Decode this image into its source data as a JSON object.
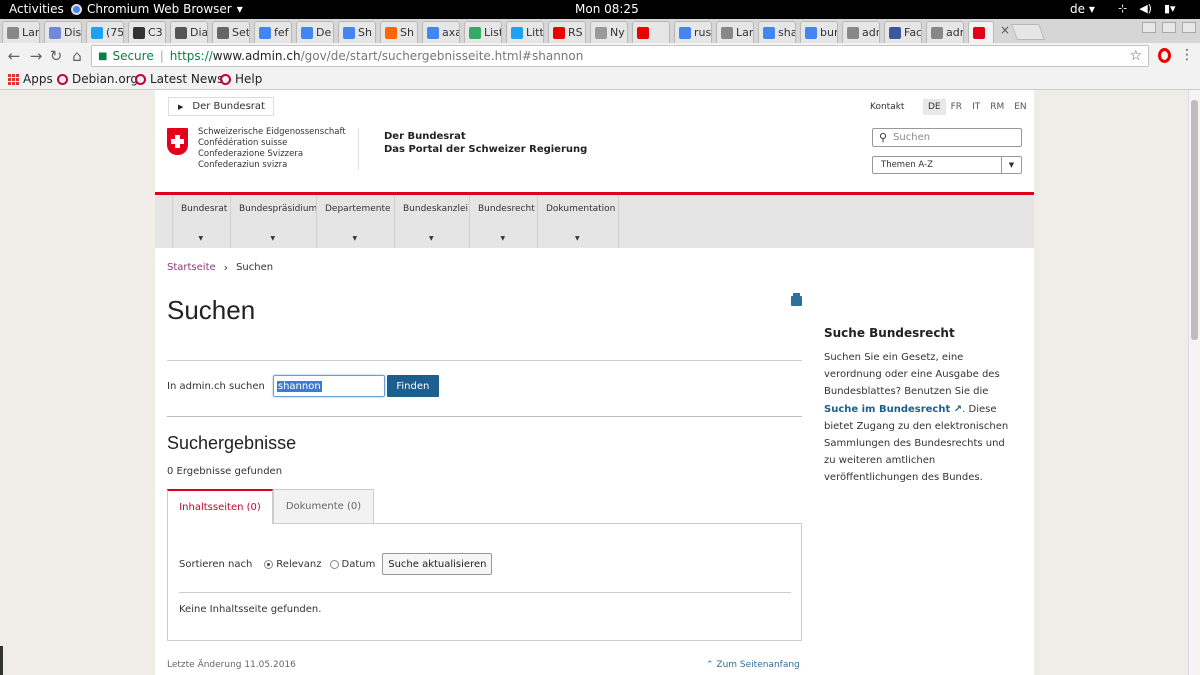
{
  "os": {
    "activities": "Activities",
    "app_name": "Chromium Web Browser",
    "clock": "Mon 08:25",
    "input_lang": "de"
  },
  "tabs": [
    {
      "label": "Lan",
      "color": "#888"
    },
    {
      "label": "Dis",
      "color": "#7289da"
    },
    {
      "label": "(75",
      "color": "#1da1f2"
    },
    {
      "label": "C3",
      "color": "#333"
    },
    {
      "label": "Dia",
      "color": "#555"
    },
    {
      "label": "Set",
      "color": "#666"
    },
    {
      "label": "fef",
      "color": "#4285f4"
    },
    {
      "label": "De",
      "color": "#4285f4"
    },
    {
      "label": "Sh",
      "color": "#4285f4"
    },
    {
      "label": "Sh",
      "color": "#ff6600"
    },
    {
      "label": "axa",
      "color": "#4285f4"
    },
    {
      "label": "List",
      "color": "#3a6"
    },
    {
      "label": "Litt",
      "color": "#1da1f2"
    },
    {
      "label": "RS",
      "color": "#e00"
    },
    {
      "label": "Ny",
      "color": "#999"
    },
    {
      "label": "",
      "color": "#e00"
    },
    {
      "label": "rus",
      "color": "#4285f4"
    },
    {
      "label": "Lan",
      "color": "#888"
    },
    {
      "label": "sha",
      "color": "#4285f4"
    },
    {
      "label": "bur",
      "color": "#4285f4"
    },
    {
      "label": "adr",
      "color": "#888"
    },
    {
      "label": "Fac",
      "color": "#3b5998"
    },
    {
      "label": "adr",
      "color": "#888"
    },
    {
      "label": "",
      "color": "#e4001b"
    }
  ],
  "toolbar": {
    "secure_label": "Secure",
    "url_proto": "https://",
    "url_host": "www.admin.ch",
    "url_path": "/gov/de/start/suchergebnisseite.html#shannon"
  },
  "bookmarks": {
    "apps": "Apps",
    "debian": "Debian.org",
    "news": "Latest News",
    "help": "Help"
  },
  "header": {
    "bundesrat_tab": "Der Bundesrat",
    "kontakt": "Kontakt",
    "languages": [
      "DE",
      "FR",
      "IT",
      "RM",
      "EN"
    ],
    "confed_lines": [
      "Schweizerische Eidgenossenschaft",
      "Confédération suisse",
      "Confederazione Svizzera",
      "Confederaziun svizra"
    ],
    "portal_line1": "Der Bundesrat",
    "portal_line2": "Das Portal der Schweizer Regierung",
    "search_placeholder": "Suchen",
    "themen": "Themen A-Z"
  },
  "nav": [
    "Bundesrat",
    "Bundespräsidium",
    "Departemente",
    "Bundeskanzlei",
    "Bundesrecht",
    "Dokumentation"
  ],
  "breadcrumb": {
    "home": "Startseite",
    "current": "Suchen"
  },
  "main": {
    "title": "Suchen",
    "search_label": "In admin.ch suchen",
    "search_value": "shannon",
    "find_button": "Finden",
    "results_title": "Suchergebnisse",
    "results_count": "0 Ergebnisse gefunden",
    "tab_pages": "Inhaltsseiten (0)",
    "tab_docs": "Dokumente (0)",
    "sort_label": "Sortieren nach",
    "sort_relevance": "Relevanz",
    "sort_date": "Datum",
    "update_button": "Suche aktualisieren",
    "no_results": "Keine Inhaltsseite gefunden.",
    "last_change": "Letzte Änderung 11.05.2016",
    "to_top": "Zum Seitenanfang"
  },
  "aside": {
    "title": "Suche Bundesrecht",
    "text_before": "Suchen Sie ein Gesetz, eine verordnung oder eine Ausgabe des Bundesblattes? Benutzen Sie die",
    "link": "Suche im Bundesrecht",
    "text_after": ". Diese bietet Zugang zu den elektronischen Sammlungen des Bundesrechts und zu weiteren amtlichen veröffentlichungen des Bundes."
  }
}
